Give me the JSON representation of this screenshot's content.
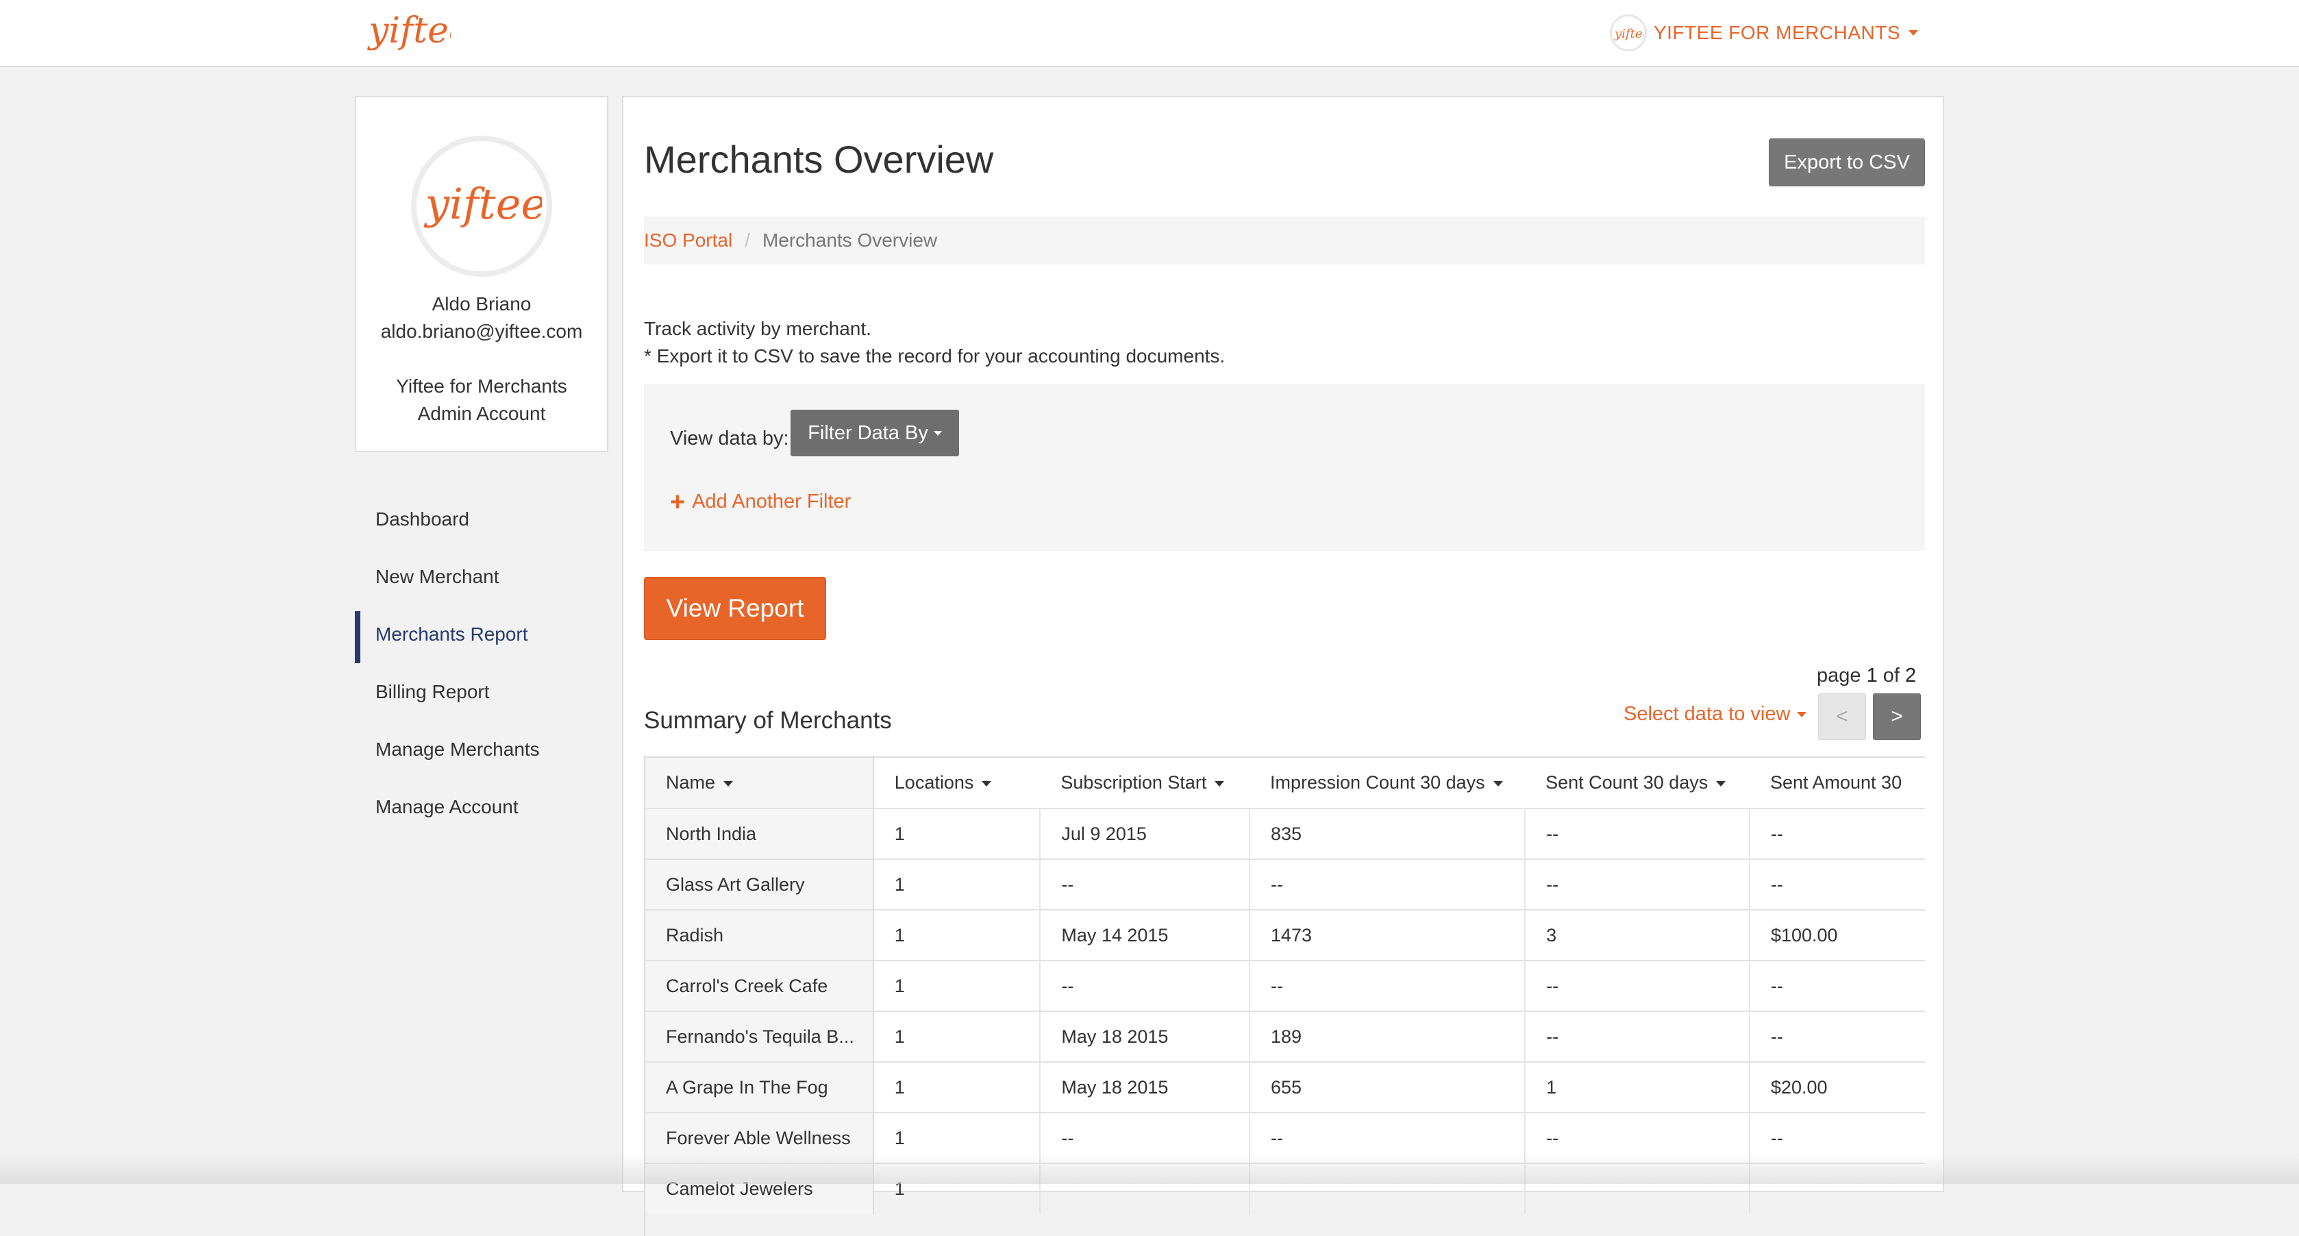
{
  "header": {
    "logo_text": "yiftee",
    "account_label": "YIFTEE FOR MERCHANTS"
  },
  "profile": {
    "name": "Aldo Briano",
    "email": "aldo.briano@yiftee.com",
    "org_line1": "Yiftee for Merchants",
    "org_line2": "Admin Account"
  },
  "sidebar": {
    "items": [
      {
        "label": "Dashboard"
      },
      {
        "label": "New Merchant"
      },
      {
        "label": "Merchants Report"
      },
      {
        "label": "Billing Report"
      },
      {
        "label": "Manage Merchants"
      },
      {
        "label": "Manage Account"
      }
    ]
  },
  "main": {
    "title": "Merchants Overview",
    "export_label": "Export to CSV",
    "breadcrumb": {
      "link": "ISO Portal",
      "separator": "/",
      "current": "Merchants Overview"
    },
    "intro_line1": "Track activity by merchant.",
    "intro_line2": "* Export it to CSV to save the record for your accounting documents.",
    "filter": {
      "label": "View data by:",
      "button": "Filter Data By",
      "add_filter": "Add Another Filter"
    },
    "view_report": "View Report",
    "pager": {
      "prefix": "page",
      "current": "1",
      "of": "of",
      "total": "2",
      "prev": "<",
      "next": ">"
    },
    "section_title": "Summary of Merchants",
    "select_data": "Select data to view"
  },
  "table": {
    "columns": [
      "Name",
      "Locations",
      "Subscription Start",
      "Impression Count 30 days",
      "Sent Count 30 days",
      "Sent Amount 30"
    ],
    "rows": [
      [
        "North India",
        "1",
        "Jul 9 2015",
        "835",
        "--",
        "--"
      ],
      [
        "Glass Art Gallery",
        "1",
        "--",
        "--",
        "--",
        "--"
      ],
      [
        "Radish",
        "1",
        "May 14 2015",
        "1473",
        "3",
        "$100.00"
      ],
      [
        "Carrol's Creek Cafe",
        "1",
        "--",
        "--",
        "--",
        "--"
      ],
      [
        "Fernando's Tequila B...",
        "1",
        "May 18 2015",
        "189",
        "--",
        "--"
      ],
      [
        "A Grape In The Fog",
        "1",
        "May 18 2015",
        "655",
        "1",
        "$20.00"
      ],
      [
        "Forever Able Wellness",
        "1",
        "--",
        "--",
        "--",
        "--"
      ],
      [
        "Camelot Jewelers",
        "1",
        "",
        "",
        "",
        ""
      ]
    ]
  },
  "colors": {
    "accent": "#e8652a",
    "nav_active": "#283a6e",
    "button_gray": "#777777"
  }
}
